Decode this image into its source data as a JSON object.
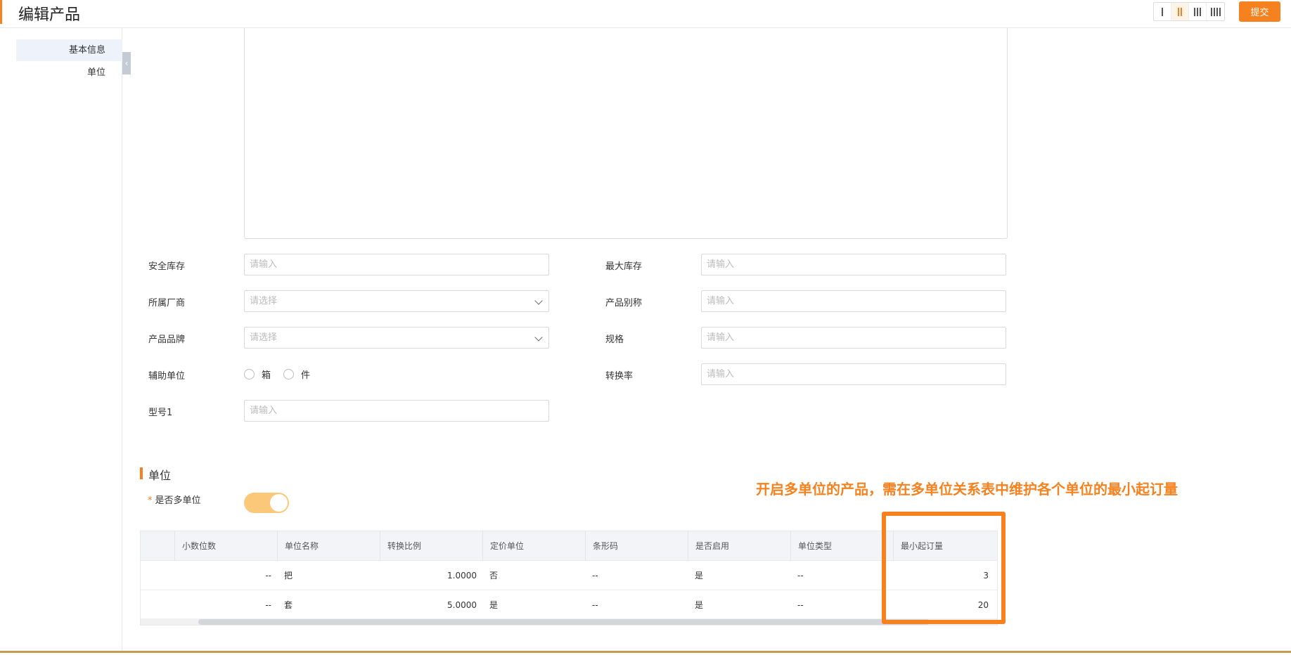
{
  "header": {
    "title": "编辑产品",
    "submit_label": "提交",
    "column_options": [
      "1-column-icon",
      "2-column-icon",
      "3-column-icon",
      "4-column-icon"
    ],
    "active_column": 2
  },
  "sidebar": {
    "items": [
      {
        "label": "基本信息",
        "active": true
      },
      {
        "label": "单位",
        "active": false
      }
    ],
    "collapse_glyph": "‹"
  },
  "form": {
    "safety_stock": {
      "label": "安全库存",
      "placeholder": "请输入"
    },
    "max_stock": {
      "label": "最大库存",
      "placeholder": "请输入"
    },
    "manufacturer": {
      "label": "所属厂商",
      "placeholder": "请选择"
    },
    "alias": {
      "label": "产品别称",
      "placeholder": "请输入"
    },
    "brand": {
      "label": "产品品牌",
      "placeholder": "请选择"
    },
    "spec": {
      "label": "规格",
      "placeholder": "请输入"
    },
    "aux_unit": {
      "label": "辅助单位",
      "options": [
        "箱",
        "件"
      ]
    },
    "conversion_rate": {
      "label": "转换率",
      "placeholder": "请输入"
    },
    "model": {
      "label": "型号1",
      "placeholder": "请输入"
    }
  },
  "unit_section": {
    "title": "单位",
    "multi_unit_label": "是否多单位",
    "required_mark": "*",
    "multi_unit_enabled": true
  },
  "annotation": "开启多单位的产品，需在多单位关系表中维护各个单位的最小起订量",
  "table": {
    "columns": [
      "小数位数",
      "单位名称",
      "转换比例",
      "定价单位",
      "条形码",
      "是否启用",
      "单位类型",
      "最小起订量"
    ],
    "rows": [
      [
        "--",
        "把",
        "1.0000",
        "否",
        "--",
        "是",
        "--",
        "3"
      ],
      [
        "--",
        "套",
        "5.0000",
        "是",
        "--",
        "是",
        "--",
        "20"
      ]
    ]
  },
  "colors": {
    "accent": "#f5821f",
    "toggle_on": "#fbc87a",
    "sidebar_active": "#eef3fb"
  }
}
